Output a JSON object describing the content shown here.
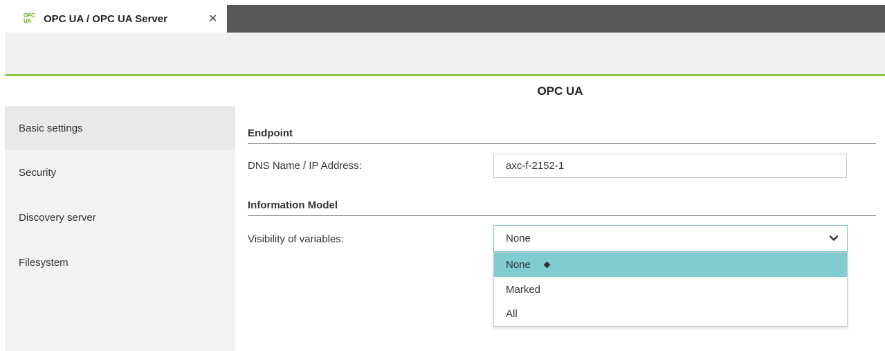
{
  "tab": {
    "icon_line1": "OPC",
    "icon_line2": "UA",
    "title": "OPC UA / OPC UA Server",
    "close": "✕"
  },
  "page": {
    "title": "OPC UA"
  },
  "sidebar": {
    "items": [
      {
        "label": "Basic settings",
        "active": true
      },
      {
        "label": "Security",
        "active": false
      },
      {
        "label": "Discovery server",
        "active": false
      },
      {
        "label": "Filesystem",
        "active": false
      }
    ]
  },
  "endpoint": {
    "heading": "Endpoint",
    "dns_label": "DNS Name / IP Address:",
    "dns_value": "axc-f-2152-1"
  },
  "info_model": {
    "heading": "Information Model",
    "visibility_label": "Visibility of variables:",
    "visibility_value": "None",
    "options": [
      "None",
      "Marked",
      "All"
    ],
    "selected_index": 0
  },
  "colors": {
    "accent_green": "#8dc63f",
    "selection_teal": "#7fcdd1",
    "tabbar_dark": "#58585a"
  }
}
